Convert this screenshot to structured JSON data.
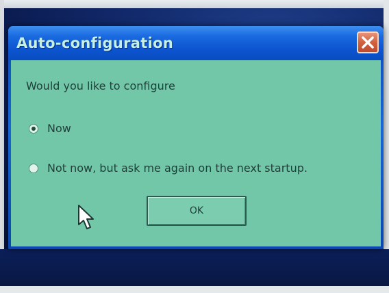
{
  "dialog": {
    "title": "Auto-configuration",
    "prompt": "Would you like to configure",
    "options": [
      {
        "label": "Now",
        "selected": true
      },
      {
        "label": "Not now, but ask me again on the next startup.",
        "selected": false
      }
    ],
    "ok_label": "OK"
  },
  "colors": {
    "titlebar": "#0c54cf",
    "client_background": "#72c7a8",
    "close_button": "#d2603f",
    "desktop": "#12296b"
  },
  "icons": {
    "close": "close-icon",
    "cursor": "mouse-pointer-icon"
  }
}
